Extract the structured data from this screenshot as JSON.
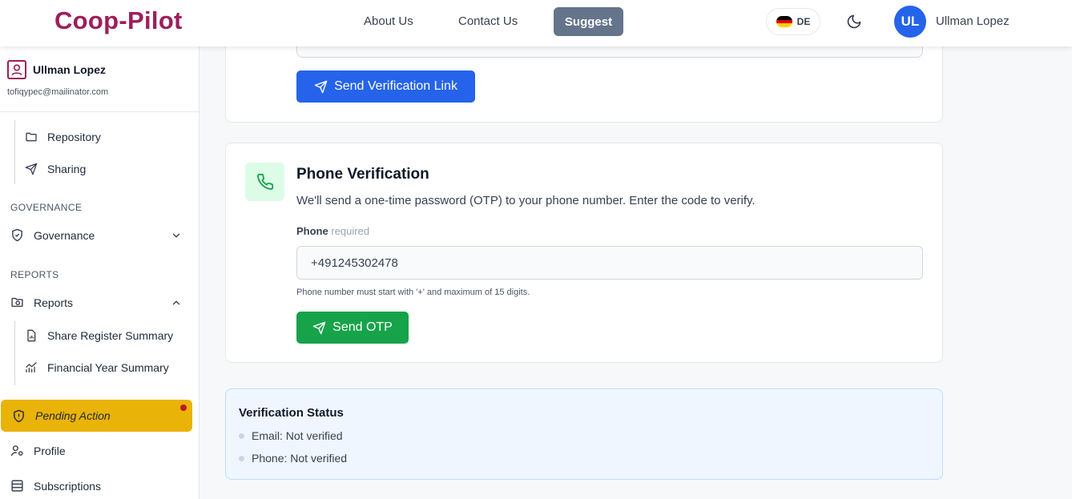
{
  "header": {
    "logo": "Coop-Pilot",
    "nav": [
      {
        "label": "About Us"
      },
      {
        "label": "Contact Us"
      }
    ],
    "suggest_label": "Suggest",
    "language": "DE",
    "avatar_initials": "UL",
    "user_name": "Ullman Lopez"
  },
  "sidebar": {
    "user_name": "Ullman Lopez",
    "user_email": "tofiqypec@mailinator.com",
    "items_top": [
      {
        "label": "Repository",
        "icon": "folder-icon"
      },
      {
        "label": "Sharing",
        "icon": "send-icon"
      }
    ],
    "governance_section": "GOVERNANCE",
    "governance_item": "Governance",
    "reports_section": "REPORTS",
    "reports_item": "Reports",
    "reports_sub": [
      {
        "label": "Share Register Summary",
        "icon": "document-chart-icon"
      },
      {
        "label": "Financial Year Summary",
        "icon": "trend-chart-icon"
      }
    ],
    "pending_action": "Pending Action",
    "profile": "Profile",
    "subscriptions": "Subscriptions"
  },
  "email_verification": {
    "button_label": "Send Verification Link"
  },
  "phone_verification": {
    "title": "Phone Verification",
    "description": "We'll send a one-time password (OTP) to your phone number. Enter the code to verify.",
    "label": "Phone",
    "required_text": "required",
    "phone_value": "+491245302478",
    "help_text": "Phone number must start with '+' and maximum of 15 digits.",
    "button_label": "Send OTP"
  },
  "verification_status": {
    "title": "Verification Status",
    "email": "Email: Not verified",
    "phone": "Phone: Not verified"
  },
  "colors": {
    "brand": "#9d1e5a",
    "primary": "#2563eb",
    "success": "#16a34a",
    "warning": "#eab308"
  }
}
